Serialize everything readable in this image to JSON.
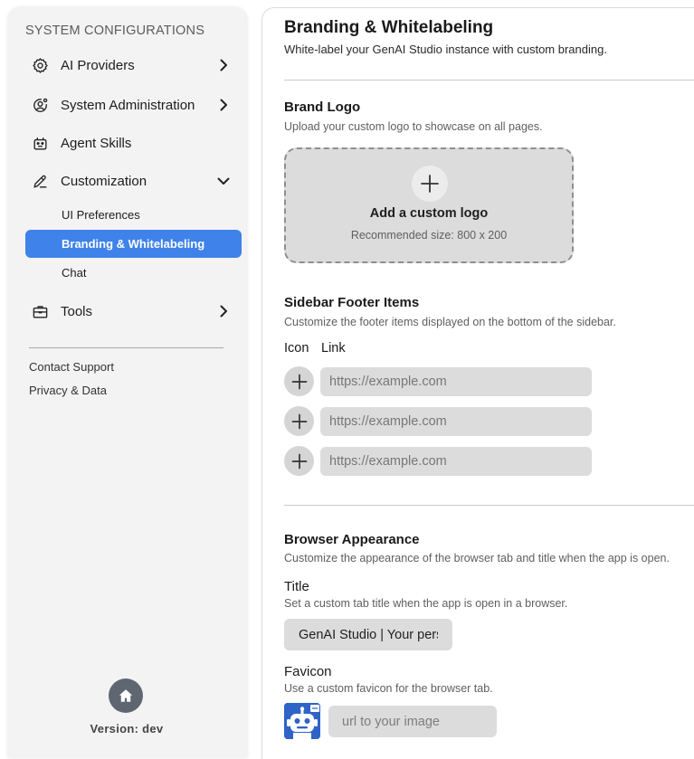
{
  "sidebar": {
    "heading": "SYSTEM CONFIGURATIONS",
    "items": [
      {
        "label": "AI Providers",
        "icon": "gear-icon"
      },
      {
        "label": "System Administration",
        "icon": "user-gear-icon"
      },
      {
        "label": "Agent Skills",
        "icon": "robot-icon"
      },
      {
        "label": "Customization",
        "icon": "pencil-icon"
      },
      {
        "label": "Tools",
        "icon": "briefcase-icon"
      }
    ],
    "sub_items": [
      {
        "label": "UI Preferences",
        "active": false
      },
      {
        "label": "Branding & Whitelabeling",
        "active": true
      },
      {
        "label": "Chat",
        "active": false
      }
    ],
    "footer_links": [
      "Contact Support",
      "Privacy & Data"
    ],
    "version": "Version: dev"
  },
  "main": {
    "title": "Branding & Whitelabeling",
    "subtitle": "White-label your GenAI Studio instance with custom branding.",
    "brand_logo": {
      "title": "Brand Logo",
      "description": "Upload your custom logo to showcase on all pages.",
      "upload_title": "Add a custom logo",
      "upload_hint": "Recommended size: 800 x 200"
    },
    "footer_items": {
      "title": "Sidebar Footer Items",
      "description": "Customize the footer items displayed on the bottom of the sidebar.",
      "col_icon": "Icon",
      "col_link": "Link",
      "rows": [
        {
          "placeholder": "https://example.com",
          "value": ""
        },
        {
          "placeholder": "https://example.com",
          "value": ""
        },
        {
          "placeholder": "https://example.com",
          "value": ""
        }
      ]
    },
    "browser": {
      "title": "Browser Appearance",
      "description": "Customize the appearance of the browser tab and title when the app is open.",
      "tab_title_label": "Title",
      "tab_title_desc": "Set a custom tab title when the app is open in a browser.",
      "tab_title_value": "GenAI Studio | Your personal LLM trained on anything",
      "favicon_label": "Favicon",
      "favicon_desc": "Use a custom favicon for the browser tab.",
      "favicon_placeholder": "url to your image"
    }
  },
  "colors": {
    "accent": "#3f82ea",
    "sidebar_bg": "#f3f3f3",
    "input_bg": "#dcdcdc",
    "home_button": "#5e6672",
    "favicon_bg": "#2f63c7"
  }
}
